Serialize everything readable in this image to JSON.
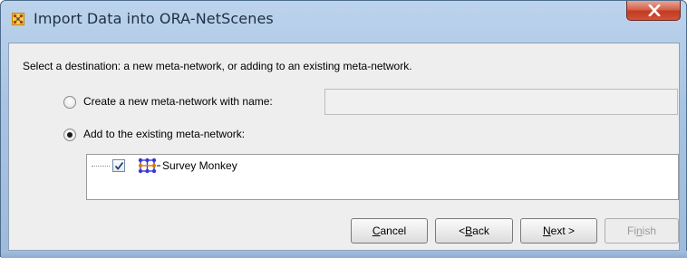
{
  "window": {
    "title": "Import Data into ORA-NetScenes",
    "close_glyph": "X",
    "icon": "ora-network-icon"
  },
  "dialog": {
    "instruction": "Select a destination: a new meta-network, or adding to an existing meta-network.",
    "option_new": {
      "label": "Create a new meta-network with name:",
      "selected": false,
      "name_value": ""
    },
    "option_existing": {
      "label": "Add to the existing meta-network:",
      "selected": true
    },
    "tree": {
      "items": [
        {
          "label": "Survey Monkey",
          "checked": true,
          "icon": "meta-network-icon"
        }
      ]
    }
  },
  "buttons": {
    "cancel": {
      "pre": "",
      "mnemonic": "C",
      "post": "ancel",
      "enabled": true
    },
    "back": {
      "pre": "< ",
      "mnemonic": "B",
      "post": "ack",
      "enabled": true
    },
    "next": {
      "pre": "",
      "mnemonic": "N",
      "post": "ext >",
      "enabled": true
    },
    "finish": {
      "pre": "Fi",
      "mnemonic": "n",
      "post": "ish",
      "enabled": false
    }
  },
  "colors": {
    "titlebar": "#a9c4e2",
    "close_button": "#c23a22",
    "network_icon": "#3a3ad6",
    "network_icon_accent": "#e07800"
  }
}
